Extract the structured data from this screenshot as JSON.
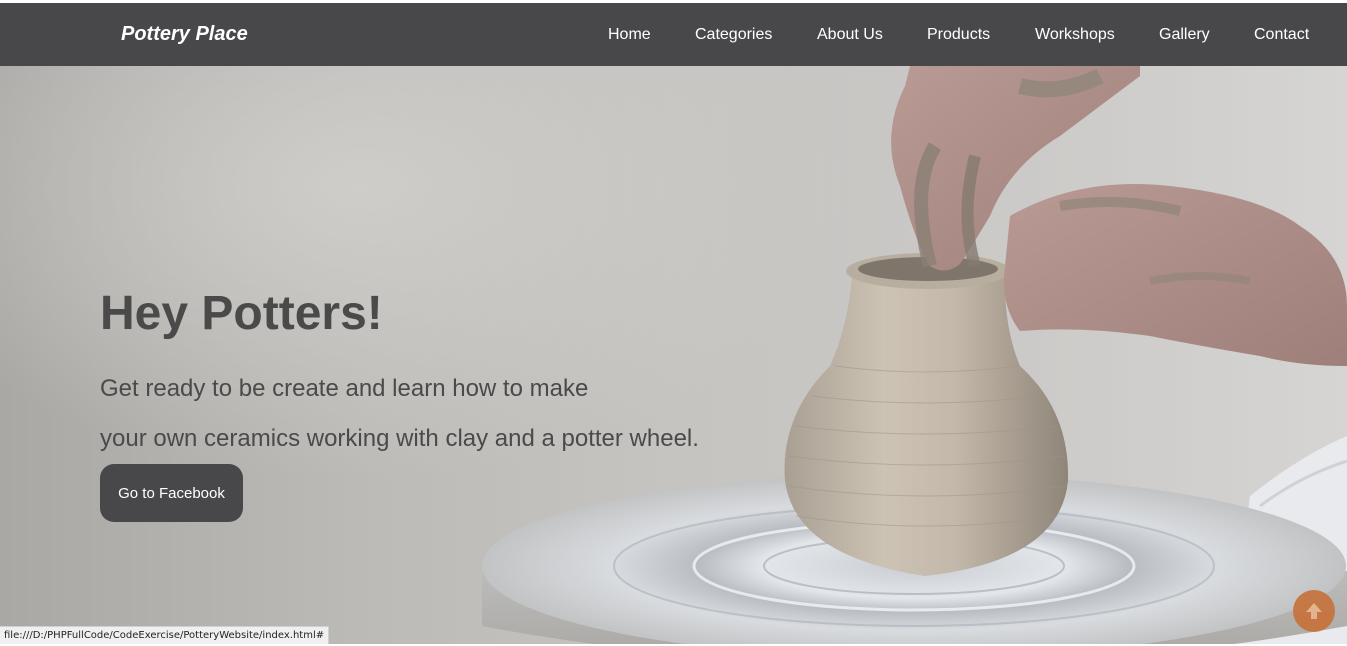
{
  "navbar": {
    "brand": "Pottery Place",
    "items": [
      {
        "label": "Home"
      },
      {
        "label": "Categories"
      },
      {
        "label": "About Us"
      },
      {
        "label": "Products"
      },
      {
        "label": "Workshops"
      },
      {
        "label": "Gallery"
      },
      {
        "label": "Contact"
      }
    ]
  },
  "hero": {
    "title": "Hey Potters!",
    "line1": "Get ready to be create and learn how to make",
    "line2": "your own ceramics working with clay and a potter wheel.",
    "button_label": "Go to Facebook"
  },
  "status_bar": {
    "url": "file:///D:/PHPFullCode/CodeExercise/PotteryWebsite/index.html#"
  },
  "icons": {
    "scroll_top": "arrow-up-icon"
  },
  "colors": {
    "navbar_bg": "#48484a",
    "button_bg": "#48484a",
    "scroll_top_bg": "#c6733c",
    "text_dark": "#4a4a4a"
  }
}
